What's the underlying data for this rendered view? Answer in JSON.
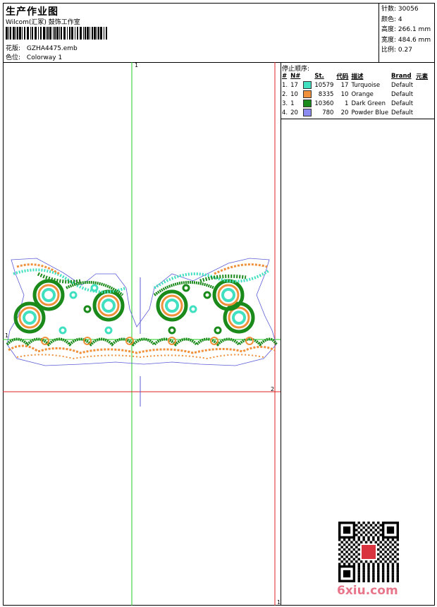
{
  "header": {
    "title": "生产作业图",
    "company": "Wilcom(汇冢) 鼓饰工作室",
    "design_file_label": "花版:",
    "design_file": "GZHA4475.emb",
    "colorway_label": "色位:",
    "colorway": "Colorway 1"
  },
  "stats": [
    {
      "label": "针数:",
      "value": "30056"
    },
    {
      "label": "颜色:",
      "value": "4"
    },
    {
      "label": "高度:",
      "value": "266.1 mm"
    },
    {
      "label": "宽度:",
      "value": "484.6 mm"
    },
    {
      "label": "比例:",
      "value": "0.27"
    }
  ],
  "stop_sequence": {
    "title": "停止顺序:",
    "columns": {
      "index": "#",
      "no": "N#",
      "st": "St.",
      "code": "代码",
      "desc": "描述",
      "brand": "Brand",
      "elem": "元素"
    },
    "rows": [
      {
        "index": "1.",
        "no": "17",
        "color": "#40e0c0",
        "st": "10579",
        "code": "17",
        "desc": "Turquoise",
        "brand": "Default"
      },
      {
        "index": "2.",
        "no": "10",
        "color": "#f0903a",
        "st": "8335",
        "code": "10",
        "desc": "Orange",
        "brand": "Default"
      },
      {
        "index": "3.",
        "no": "1",
        "color": "#1a8a1a",
        "st": "10360",
        "code": "1",
        "desc": "Dark Green",
        "brand": "Default"
      },
      {
        "index": "4.",
        "no": "20",
        "color": "#8c8cf0",
        "st": "780",
        "code": "20",
        "desc": "Powder Blue",
        "brand": "Default"
      }
    ]
  },
  "guides": {
    "v_label": "1",
    "h_label": "1",
    "frame_label": "2",
    "corner_label": "1"
  },
  "watermark": "6xiu.com",
  "colors": {
    "guide_green": "#22cc22",
    "guide_red": "#e02020",
    "outline": "#5b5bd6"
  }
}
